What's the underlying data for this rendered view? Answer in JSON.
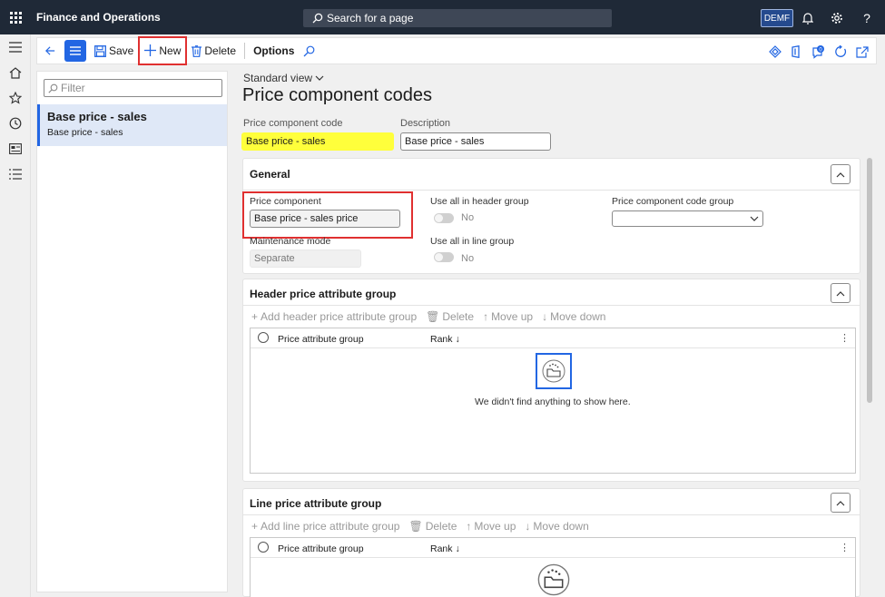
{
  "app": {
    "title": "Finance and Operations",
    "search_placeholder": "Search for a page",
    "company": "DEMF"
  },
  "toolbar": {
    "save_label": "Save",
    "new_label": "New",
    "delete_label": "Delete",
    "options_label": "Options"
  },
  "list": {
    "filter_placeholder": "Filter",
    "items": [
      {
        "title": "Base price - sales",
        "subtitle": "Base price - sales"
      }
    ]
  },
  "page": {
    "view_label": "Standard view",
    "title": "Price component codes",
    "code_label": "Price component code",
    "code_value": "Base price - sales",
    "description_label": "Description",
    "description_value": "Base price - sales"
  },
  "general": {
    "title": "General",
    "price_component_label": "Price component",
    "price_component_value": "Base price - sales price",
    "maintenance_label": "Maintenance mode",
    "maintenance_value": "Separate",
    "header_group_label": "Use all in header group",
    "header_group_value": "No",
    "line_group_label": "Use all in line group",
    "line_group_value": "No",
    "code_group_label": "Price component code group",
    "code_group_value": ""
  },
  "header_group": {
    "title": "Header price attribute group",
    "add_label": "Add header price attribute group",
    "delete_label": "Delete",
    "move_up_label": "Move up",
    "move_down_label": "Move down",
    "col_group": "Price attribute group",
    "col_rank": "Rank",
    "empty_text": "We didn't find anything to show here."
  },
  "line_group": {
    "title": "Line price attribute group",
    "add_label": "Add line price attribute group",
    "delete_label": "Delete",
    "move_up_label": "Move up",
    "move_down_label": "Move down",
    "col_group": "Price attribute group",
    "col_rank": "Rank"
  },
  "colors": {
    "topbar": "#1f2937",
    "accent": "#2266e3",
    "highlight_red": "#e03030",
    "highlight_yellow": "#ffff3b"
  }
}
